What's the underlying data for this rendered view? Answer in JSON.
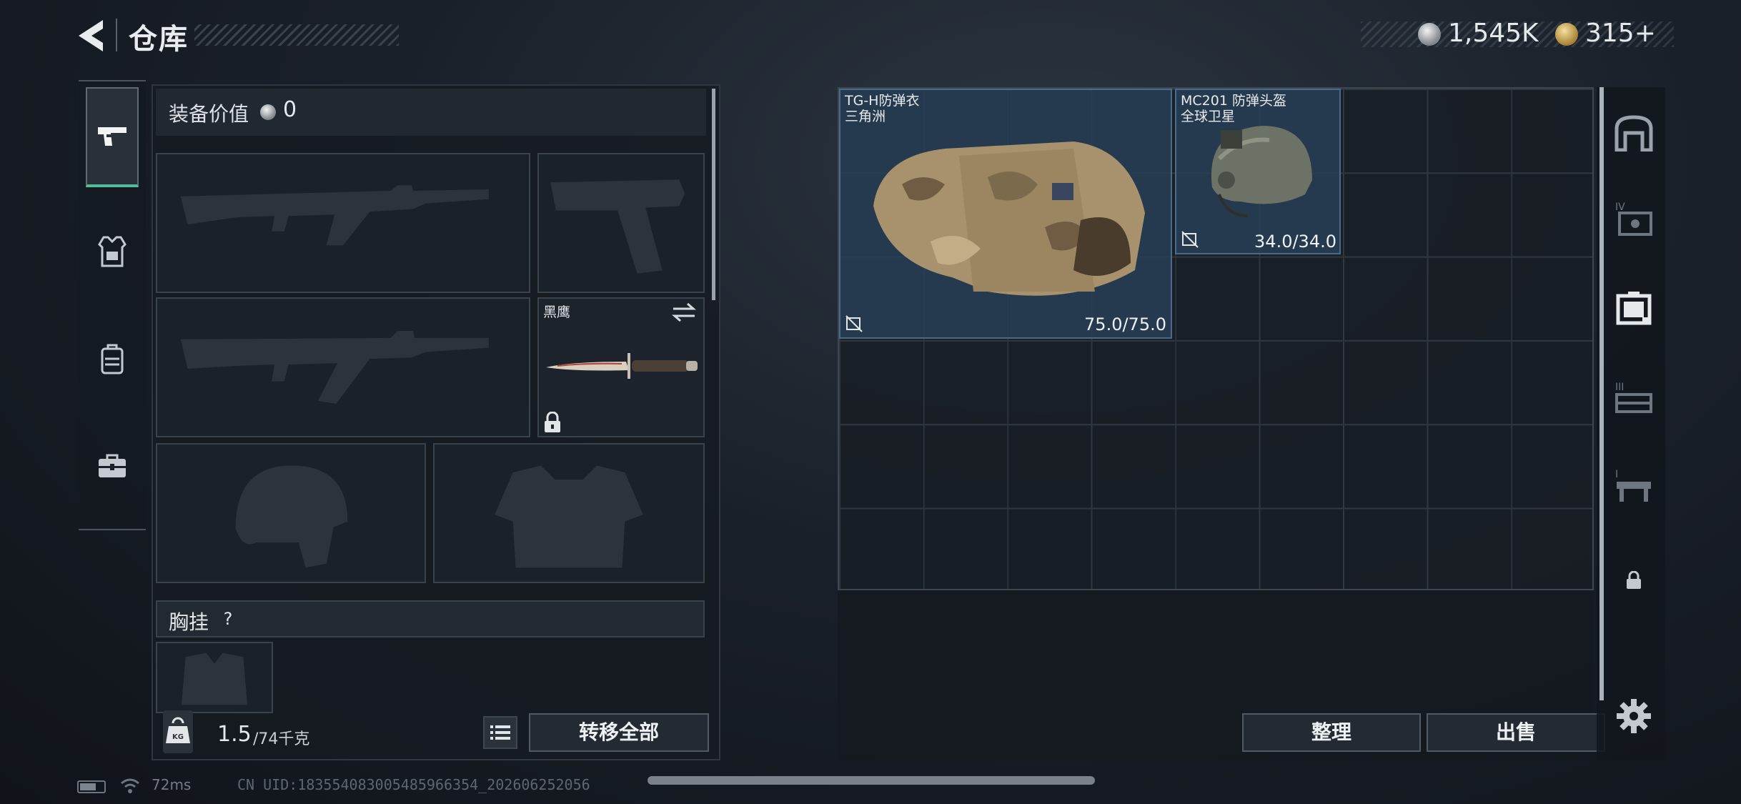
{
  "header": {
    "title": "仓库",
    "back_icon": "chevron-left-icon"
  },
  "currencies": {
    "silver": {
      "icon": "silver-coin-icon",
      "amount": "1,545K"
    },
    "gold": {
      "icon": "gold-coin-icon",
      "amount": "315+"
    }
  },
  "side_tabs": [
    {
      "name": "weapons",
      "icon": "pistol-icon",
      "active": true
    },
    {
      "name": "armor",
      "icon": "armor-icon",
      "active": false
    },
    {
      "name": "backpack",
      "icon": "backpack-icon",
      "active": false
    },
    {
      "name": "tools",
      "icon": "toolbox-icon",
      "active": false
    }
  ],
  "loadout": {
    "value_label": "装备价值",
    "value_amount": "0",
    "slots": {
      "primary_1": {
        "icon": "rifle-silhouette-icon"
      },
      "pistol": {
        "icon": "pistol-silhouette-icon"
      },
      "primary_2": {
        "icon": "rifle-silhouette-icon"
      },
      "melee": {
        "name": "黑鹰",
        "icon": "knife-icon",
        "locked": true
      },
      "helmet": {
        "icon": "helmet-silhouette-icon"
      },
      "body_armor": {
        "icon": "vest-silhouette-icon"
      }
    },
    "chest_rig_label": "胸挂",
    "chest_rig_help": "?",
    "weight_current": "1.5",
    "weight_capacity": "/74千克",
    "transfer_all": "转移全部"
  },
  "storage": {
    "items": [
      {
        "name_line1": "TG-H防弹衣",
        "name_line2": "三角洲",
        "durability": "75.0/75.0"
      },
      {
        "name_line1": "MC201 防弹头盔",
        "name_line2": "全球卫星",
        "durability": "34.0/34.0"
      }
    ],
    "sort_label": "整理",
    "sell_label": "出售"
  },
  "status_bar": {
    "ping": "72ms",
    "uid": "CN UID:1835540830054859​66354_202606252056"
  },
  "colors": {
    "accent_green": "#4fbf9a",
    "item_bg_blue": "#28405a"
  }
}
